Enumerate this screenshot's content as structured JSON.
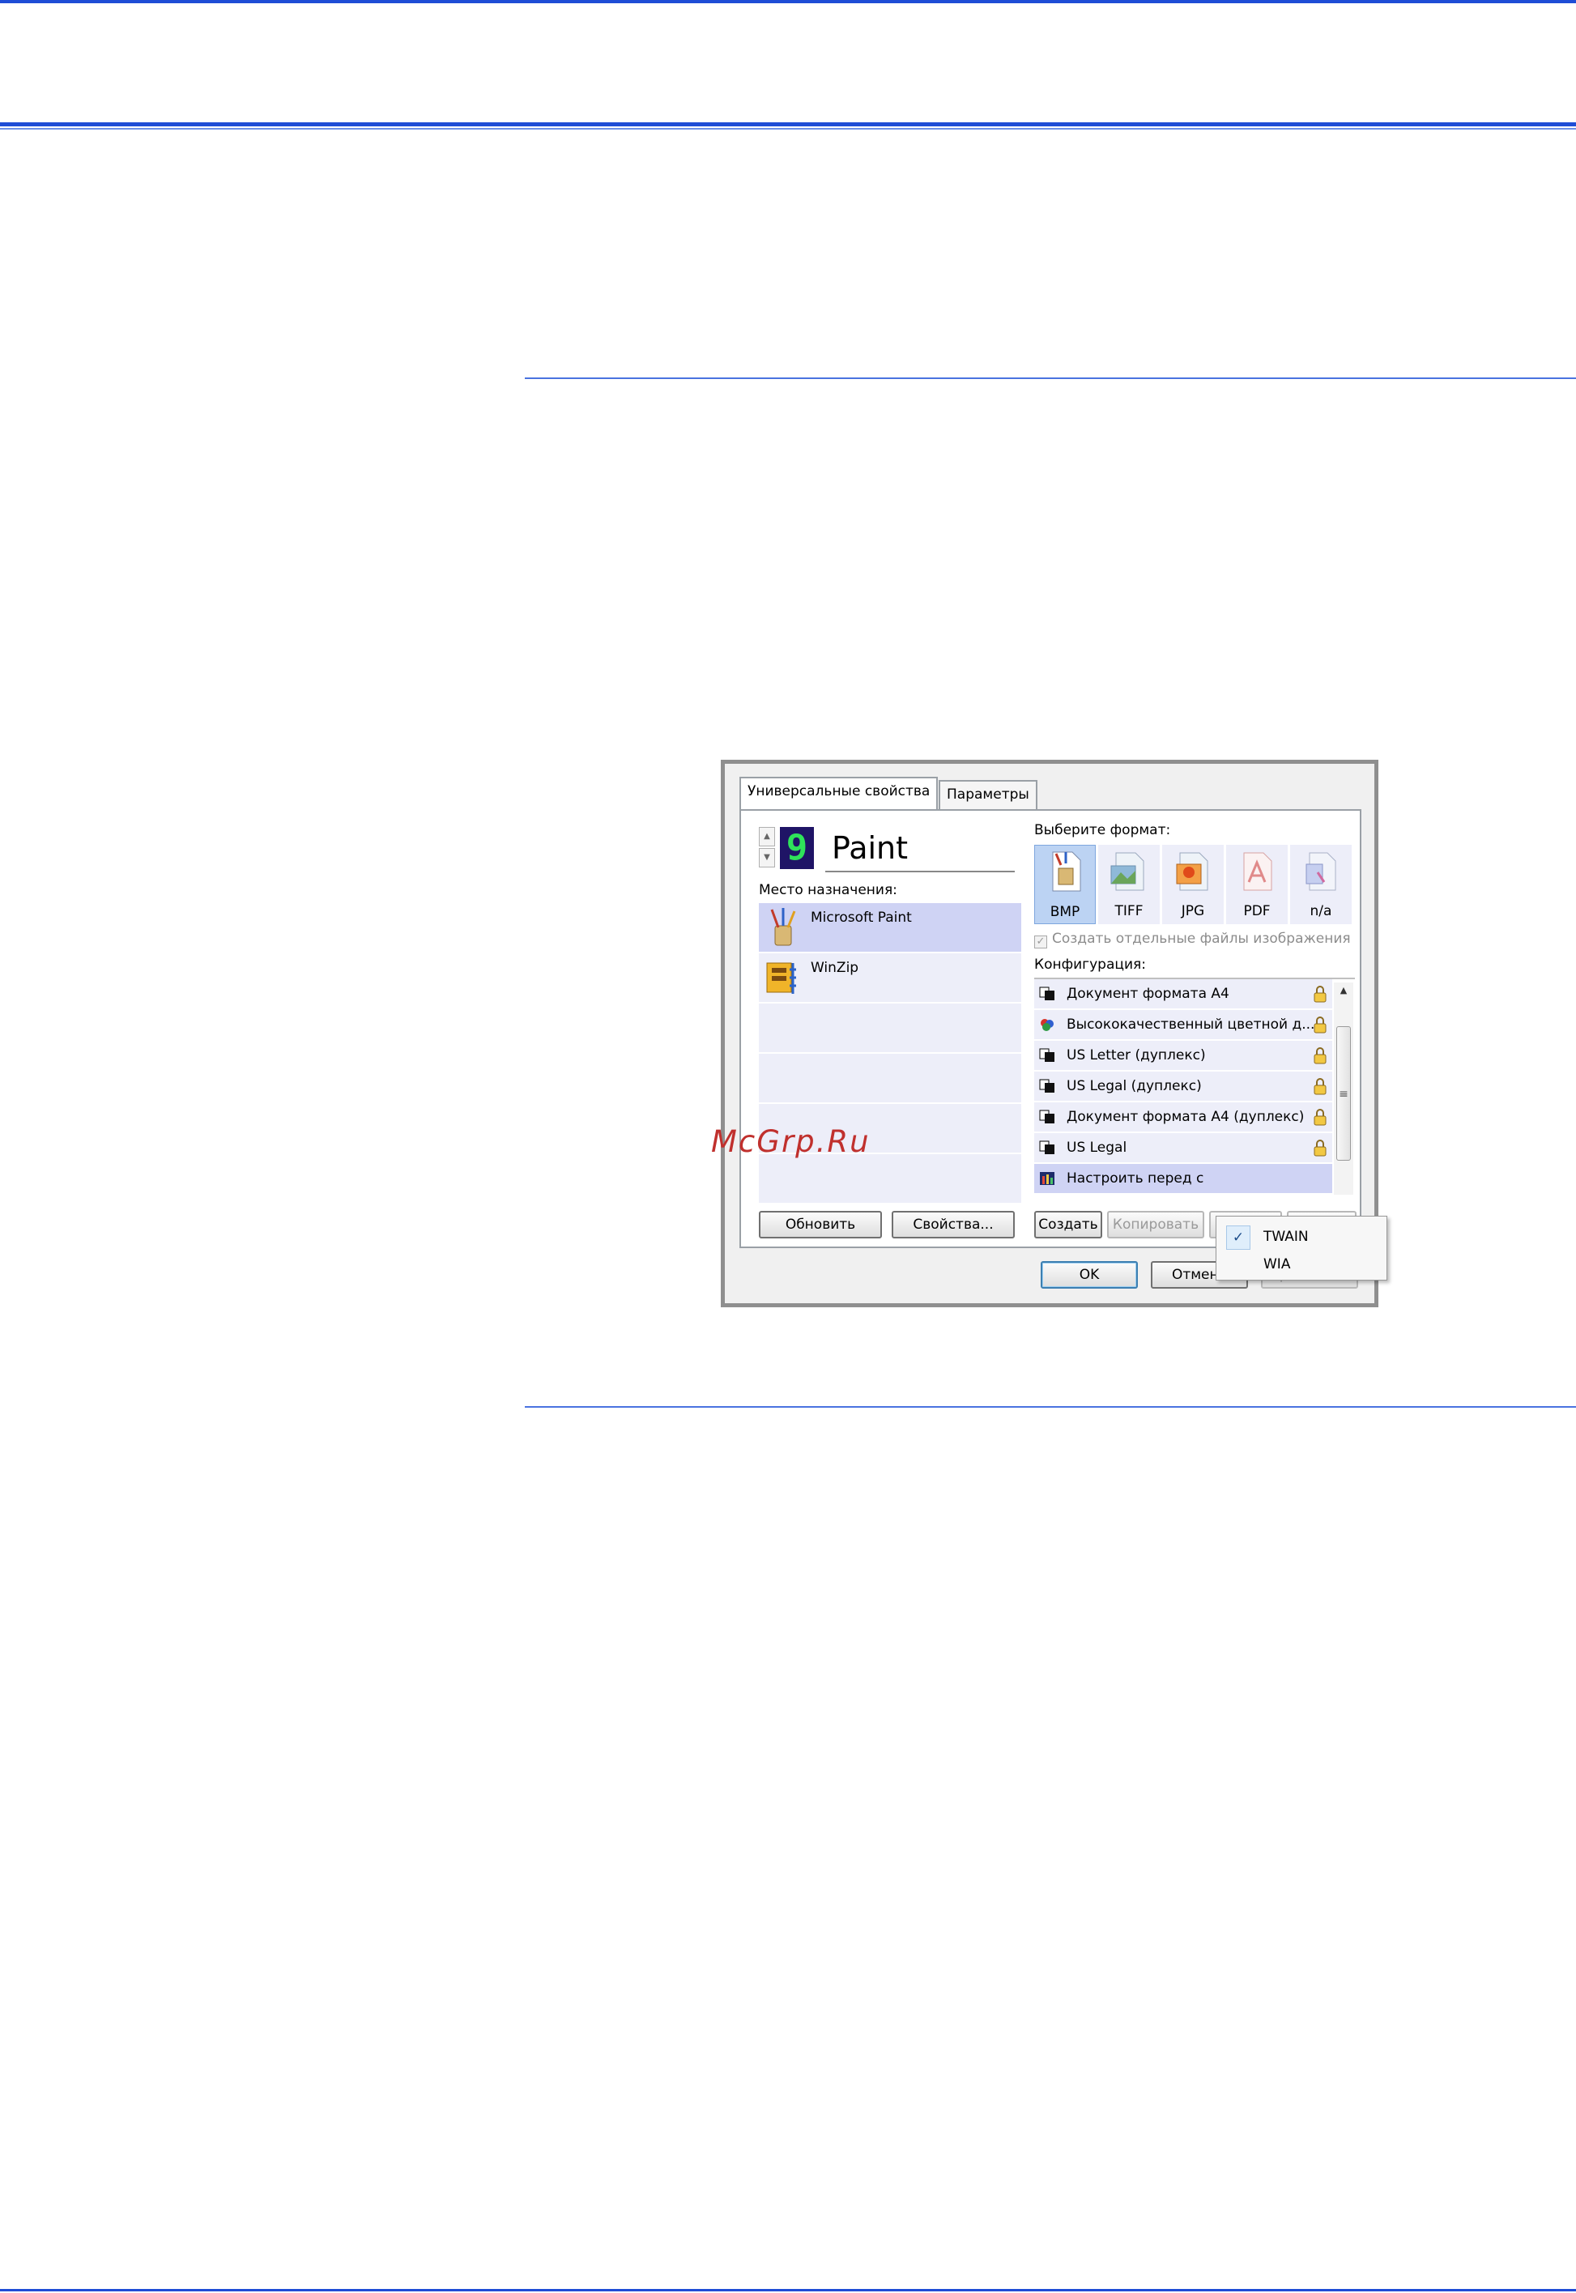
{
  "colors": {
    "rule_blue": "#1f4dd6",
    "rule_light_blue": "#6b8fe8",
    "watermark": "#c0302d"
  },
  "dialog": {
    "tabs": [
      "Универсальные свойства",
      "Параметры"
    ],
    "profile_number": "9",
    "profile_name": "Paint",
    "destination_label": "Место назначения:",
    "destinations": [
      {
        "label": "Microsoft Paint",
        "icon": "paint-brushes-icon",
        "selected": true
      },
      {
        "label": "WinZip",
        "icon": "winzip-icon",
        "selected": false
      },
      {
        "label": "",
        "icon": "",
        "selected": false
      },
      {
        "label": "",
        "icon": "",
        "selected": false
      },
      {
        "label": "",
        "icon": "",
        "selected": false
      },
      {
        "label": "",
        "icon": "",
        "selected": false
      }
    ],
    "buttons_left": {
      "refresh": "Обновить",
      "properties": "Свойства..."
    },
    "format_label": "Выберите формат:",
    "formats": [
      {
        "label": "BMP",
        "icon": "bmp-file-icon",
        "selected": true
      },
      {
        "label": "TIFF",
        "icon": "tiff-file-icon",
        "selected": false
      },
      {
        "label": "JPG",
        "icon": "jpg-file-icon",
        "selected": false
      },
      {
        "label": "PDF",
        "icon": "pdf-file-icon",
        "selected": false
      },
      {
        "label": "n/a",
        "icon": "na-file-icon",
        "selected": false
      }
    ],
    "separate_files_checkbox": "Создать отдельные файлы изображения",
    "config_label": "Конфигурация:",
    "configs": [
      {
        "label": "Документ формата A4",
        "icon": "bw-document-icon",
        "locked": true
      },
      {
        "label": "Высококачественный цветной д...",
        "icon": "color-document-icon",
        "locked": true
      },
      {
        "label": "US Letter (дуплекс)",
        "icon": "bw-document-icon",
        "locked": true
      },
      {
        "label": "US Legal (дуплекс)",
        "icon": "bw-document-icon",
        "locked": true
      },
      {
        "label": "Документ формата A4 (дуплекс)",
        "icon": "bw-document-icon",
        "locked": true
      },
      {
        "label": "US Legal",
        "icon": "bw-document-icon",
        "locked": true
      },
      {
        "label": "Настроить перед с",
        "icon": "configure-scan-icon",
        "locked": false
      }
    ],
    "config_buttons": {
      "create": "Создать",
      "copy": "Копировать"
    },
    "popup_menu": [
      {
        "label": "TWAIN",
        "checked": true
      },
      {
        "label": "WIA",
        "checked": false
      }
    ],
    "footer_buttons": {
      "ok": "OK",
      "cancel": "Отмена",
      "apply": "Применить"
    }
  },
  "watermark": "McGrp.Ru"
}
